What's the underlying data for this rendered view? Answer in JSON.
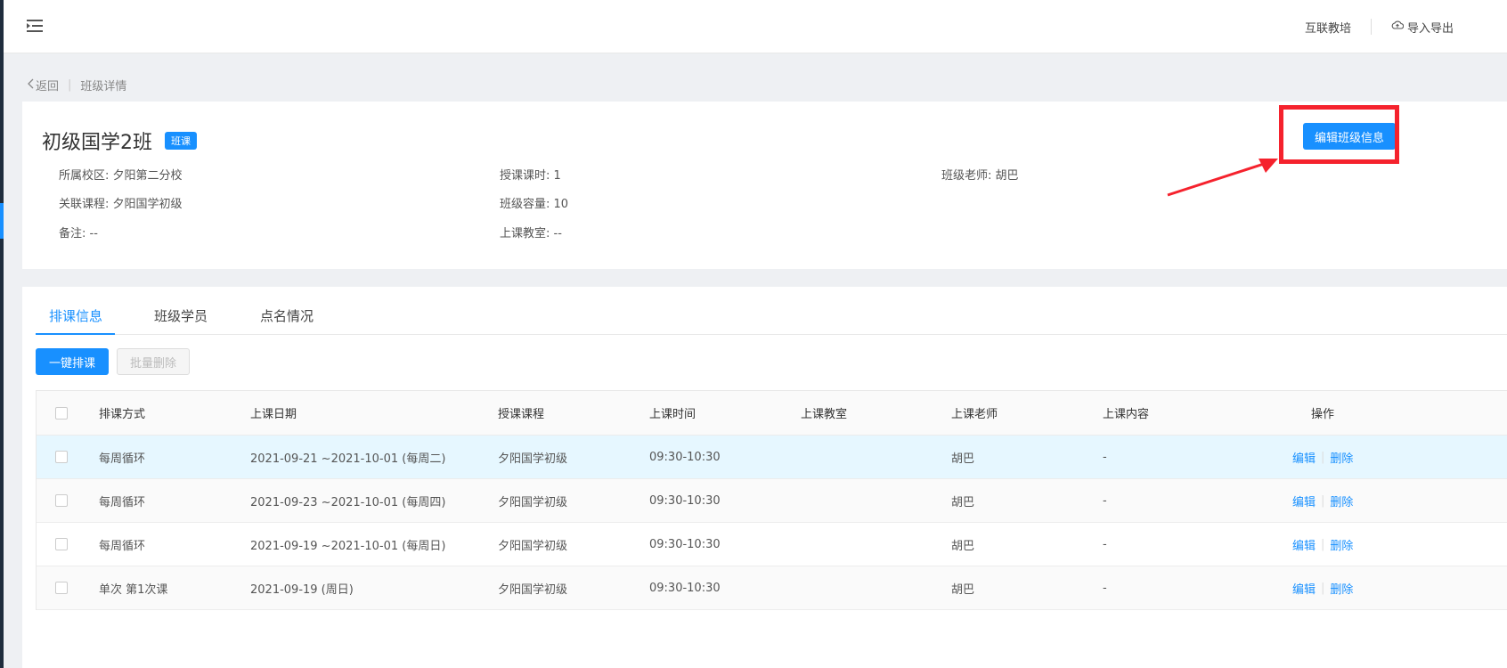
{
  "header": {
    "menu_icon": "menu-fold-icon",
    "links": [
      {
        "label": "互联教培",
        "icon": ""
      },
      {
        "label": "导入导出",
        "icon": "cloud-icon"
      }
    ]
  },
  "breadcrumb": {
    "back_label": "返回",
    "current": "班级详情"
  },
  "class_info": {
    "title": "初级国学2班",
    "tag": "班课",
    "fields": [
      {
        "label": "所属校区:",
        "value": "夕阳第二分校"
      },
      {
        "label": "授课课时:",
        "value": "1"
      },
      {
        "label": "班级老师:",
        "value": "胡巴"
      },
      {
        "label": "关联课程:",
        "value": "夕阳国学初级"
      },
      {
        "label": "班级容量:",
        "value": "10"
      },
      {
        "label": "备注:",
        "value": "--"
      },
      {
        "label": "上课教室:",
        "value": "--"
      }
    ],
    "edit_button": "编辑班级信息",
    "highlight_color": "#f5222d"
  },
  "tabs": [
    {
      "label": "排课信息",
      "active": true
    },
    {
      "label": "班级学员",
      "active": false
    },
    {
      "label": "点名情况",
      "active": false
    }
  ],
  "toolbar": {
    "primary_label": "一键排课",
    "batch_delete_label": "批量删除"
  },
  "table": {
    "columns": [
      "排课方式",
      "上课日期",
      "授课课程",
      "上课时间",
      "上课教室",
      "上课老师",
      "上课内容",
      "操作"
    ],
    "rows": [
      {
        "mode": "每周循环",
        "date": "2021-09-21 ~2021-10-01 (每周二)",
        "course": "夕阳国学初级",
        "time": "09:30-10:30",
        "room": "",
        "teacher": "胡巴",
        "content": "-",
        "edit": "编辑",
        "delete": "删除"
      },
      {
        "mode": "每周循环",
        "date": "2021-09-23 ~2021-10-01 (每周四)",
        "course": "夕阳国学初级",
        "time": "09:30-10:30",
        "room": "",
        "teacher": "胡巴",
        "content": "-",
        "edit": "编辑",
        "delete": "删除"
      },
      {
        "mode": "每周循环",
        "date": "2021-09-19 ~2021-10-01 (每周日)",
        "course": "夕阳国学初级",
        "time": "09:30-10:30",
        "room": "",
        "teacher": "胡巴",
        "content": "-",
        "edit": "编辑",
        "delete": "删除"
      },
      {
        "mode": "单次 第1次课",
        "date": "2021-09-19 (周日)",
        "course": "夕阳国学初级",
        "time": "09:30-10:30",
        "room": "",
        "teacher": "胡巴",
        "content": "-",
        "edit": "编辑",
        "delete": "删除"
      }
    ]
  },
  "colors": {
    "primary": "#1890ff",
    "row_hover": "#e6f7ff",
    "annotation_red": "#f5222d"
  }
}
